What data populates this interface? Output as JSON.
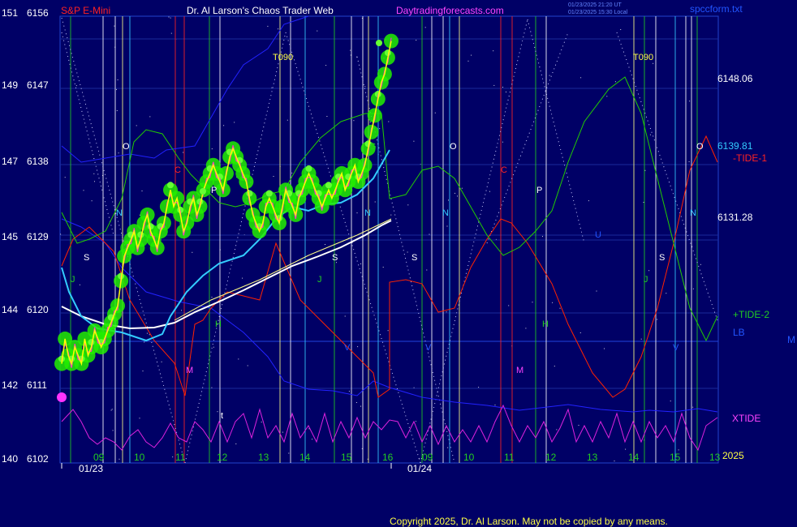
{
  "header": {
    "symbol": "S&P E-Mini",
    "title": "Dr. Al Larson's Chaos Trader Web",
    "site": "Daytradingforecasts.com",
    "stamp1": "01/23/2025 21:20 UT",
    "stamp2": "01/23/2025 15:30 Local",
    "file": "spccform.txt"
  },
  "copyright": "Copyright 2025, Dr. Al Larson. May not be copied by any means.",
  "colors": {
    "background": "#000066",
    "plot_border": "#2244cc",
    "price": "#ffff00",
    "price_glow": "#22ee00",
    "fast_ma": "#33ccff",
    "slow_ma": "#ffffff",
    "tide_minus1": "#ff2200",
    "tide_plus2": "#22cc00",
    "lb": "#2222ff",
    "xtide": "#dd22dd",
    "magenta_line": "#ff33cc"
  },
  "chart_data": {
    "type": "line",
    "title": "S&P E-Mini",
    "x_tick_labels": [
      "09",
      "10",
      "11",
      "12",
      "13",
      "14",
      "15",
      "16",
      "09",
      "10",
      "11",
      "12",
      "13",
      "14",
      "15",
      "13"
    ],
    "date_labels": [
      "01/23",
      "01/24"
    ],
    "y_labels_left": [
      {
        "index": "151",
        "price": "6156"
      },
      {
        "index": "149",
        "price": "6147"
      },
      {
        "index": "147",
        "price": "6138"
      },
      {
        "index": "145",
        "price": "6129"
      },
      {
        "index": "144",
        "price": "6120"
      },
      {
        "index": "142",
        "price": "6111"
      },
      {
        "index": "140",
        "price": "6102"
      }
    ],
    "ylim": [
      6102,
      6156
    ],
    "right_labels": {
      "value1": "6148.06",
      "value2": "6139.81",
      "value3": "6131.28",
      "tide_minus1": "-TIDE-1",
      "tide_plus2": "+TIDE-2",
      "lb": "LB",
      "xtide": "XTIDE",
      "year": "2025",
      "edge": "M"
    },
    "marker_labels": [
      "T090",
      "T090",
      "O",
      "O",
      "O",
      "P",
      "P",
      "N",
      "N",
      "N",
      "N",
      "S",
      "S",
      "S",
      "S",
      "J",
      "J",
      "J",
      "H",
      "H",
      "M",
      "M",
      "V",
      "V",
      "V",
      "C",
      "C",
      "U",
      "t",
      "G"
    ],
    "series": [
      {
        "name": "price",
        "x": [
          0,
          2,
          4,
          6,
          8,
          10,
          12,
          14,
          16,
          18,
          20,
          22,
          24,
          26,
          28,
          30,
          32,
          34,
          36,
          38,
          40,
          42,
          44,
          46,
          48,
          50,
          52,
          54,
          56,
          58,
          60,
          62,
          64,
          66,
          68,
          70,
          72,
          74,
          76,
          78,
          80,
          82,
          84,
          86,
          88,
          90,
          92,
          94,
          96,
          98,
          100,
          102,
          104,
          106,
          108,
          110,
          112,
          114,
          116,
          118,
          120,
          122,
          124,
          126,
          128,
          130,
          132,
          134,
          136,
          138,
          140,
          142,
          144,
          146,
          148,
          150,
          152,
          154,
          156,
          158,
          160,
          162,
          164,
          166,
          168,
          170,
          172,
          174,
          176,
          178,
          180,
          182,
          184,
          186,
          188,
          190,
          192,
          194,
          196,
          198,
          200
        ],
        "values": [
          6114,
          6117,
          6115,
          6114,
          6116,
          6115,
          6114,
          6117,
          6115,
          6116,
          6118,
          6117,
          6116,
          6117,
          6118,
          6119,
          6120,
          6121,
          6124,
          6127,
          6128,
          6129,
          6130,
          6128,
          6129,
          6131,
          6132,
          6130,
          6129,
          6128,
          6130,
          6131,
          6133,
          6135,
          6133,
          6134,
          6132,
          6130,
          6131,
          6133,
          6134,
          6132,
          6133,
          6135,
          6136,
          6137,
          6138,
          6137,
          6136,
          6135,
          6137,
          6139,
          6140,
          6139,
          6138,
          6137,
          6136,
          6134,
          6132,
          6131,
          6130,
          6131,
          6133,
          6134,
          6133,
          6132,
          6131,
          6133,
          6135,
          6134,
          6133,
          6132,
          6134,
          6135,
          6136,
          6137,
          6136,
          6135,
          6134,
          6133,
          6134,
          6135,
          6134,
          6135,
          6136,
          6137,
          6135,
          6136,
          6137,
          6138,
          6136,
          6137,
          6138,
          6140,
          6142,
          6144,
          6146,
          6148,
          6149,
          6151,
          6153
        ]
      }
    ]
  }
}
